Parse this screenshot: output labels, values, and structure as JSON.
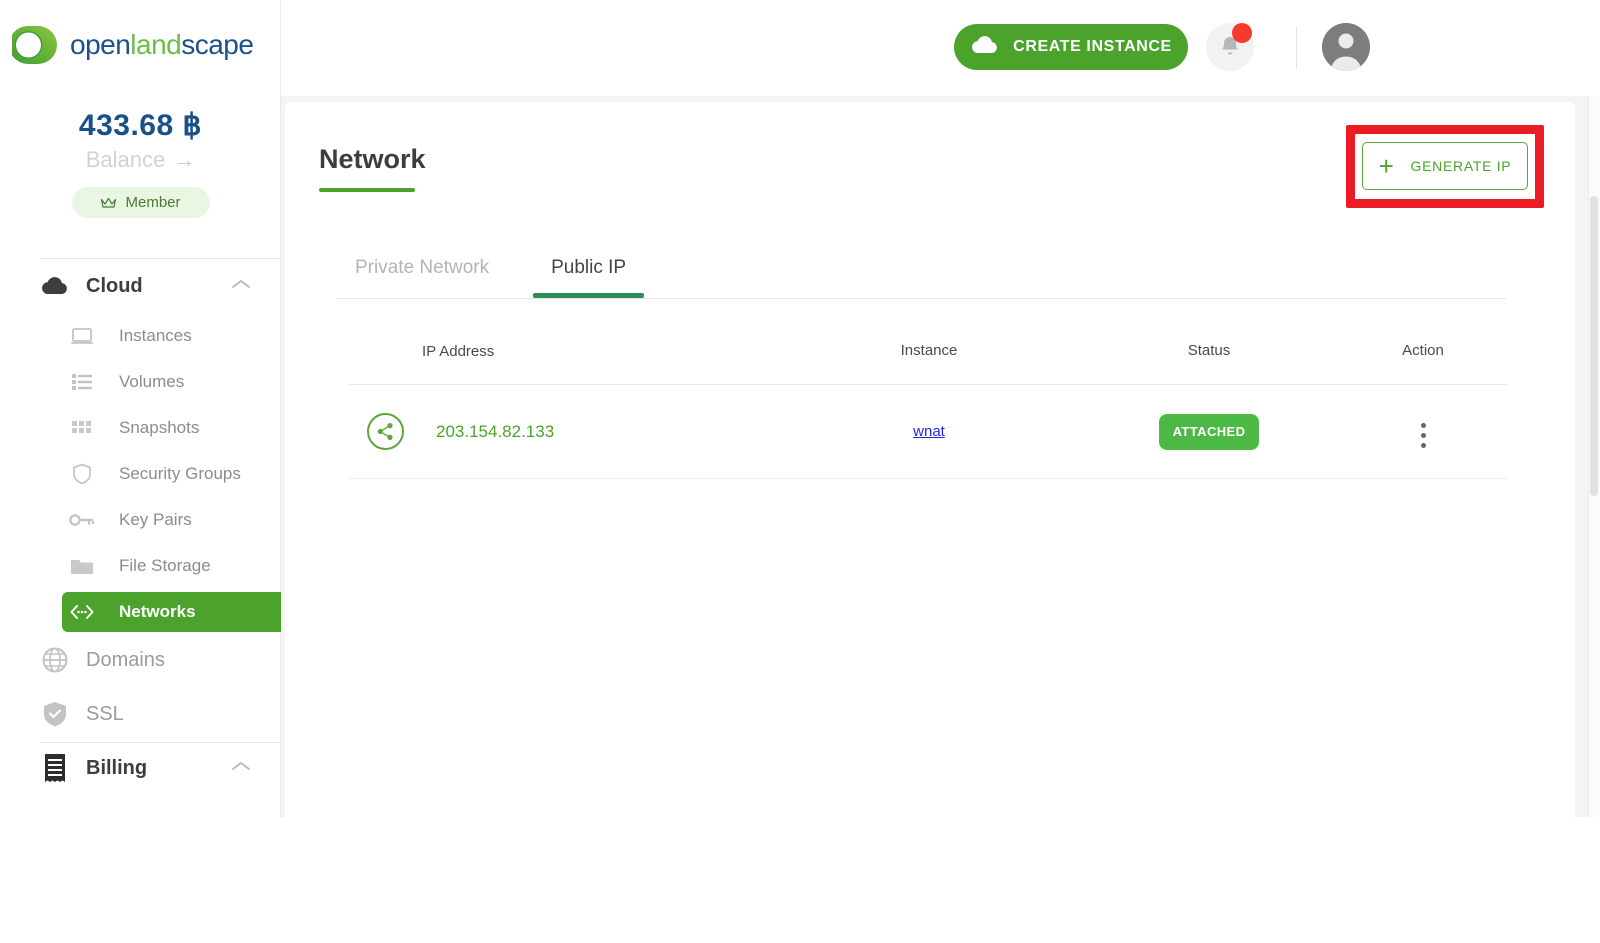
{
  "brand": {
    "name_part1": "open",
    "name_part2": "land",
    "name_part3": "scape",
    "logo_green": "#6cbe45",
    "logo_blue": "#1d4f8c"
  },
  "sidebar": {
    "balance_amount": "433.68 ฿",
    "balance_label": "Balance",
    "balance_arrow": "→",
    "member_badge": "Member",
    "groups": [
      {
        "label": "Cloud",
        "icon": "cloud-icon",
        "chevron": "chevron-up-icon",
        "items": [
          {
            "label": "Instances",
            "icon": "laptop-icon",
            "active": false
          },
          {
            "label": "Volumes",
            "icon": "list-icon",
            "active": false
          },
          {
            "label": "Snapshots",
            "icon": "grid-icon",
            "active": false
          },
          {
            "label": "Security Groups",
            "icon": "shield-icon",
            "active": false
          },
          {
            "label": "Key Pairs",
            "icon": "key-icon",
            "active": false
          },
          {
            "label": "File Storage",
            "icon": "folder-icon",
            "active": false
          },
          {
            "label": "Networks",
            "icon": "network-icon",
            "active": true
          }
        ]
      },
      {
        "label": "Domains",
        "icon": "globe-icon",
        "chevron": ""
      },
      {
        "label": "SSL",
        "icon": "shield-check-icon",
        "chevron": ""
      },
      {
        "label": "Billing",
        "icon": "receipt-icon",
        "chevron": "chevron-up-icon"
      }
    ],
    "active_color": "#4ba32b"
  },
  "topbar": {
    "create_instance_label": "CREATE INSTANCE",
    "create_instance_icon": "cloud-icon",
    "create_instance_color": "#4ba32b",
    "bell_icon": "bell-icon",
    "bell_has_notification": true,
    "notification_dot_color": "#f5392c",
    "avatar_icon": "user-avatar-icon"
  },
  "main": {
    "page_title": "Network",
    "generate_ip_label": "GENERATE IP",
    "generate_ip_plus": "+",
    "highlight_color": "#ec1c24",
    "tabs": [
      {
        "label": "Private Network",
        "active": false
      },
      {
        "label": "Public IP",
        "active": true
      }
    ],
    "table": {
      "columns": [
        "IP Address",
        "Instance",
        "Status",
        "Action"
      ],
      "rows": [
        {
          "share_icon": "share-icon",
          "ip_address": "203.154.82.133",
          "instance": "wnat",
          "status": "ATTACHED",
          "status_color": "#4cb944",
          "action_icon": "kebab-menu-icon"
        }
      ]
    }
  }
}
